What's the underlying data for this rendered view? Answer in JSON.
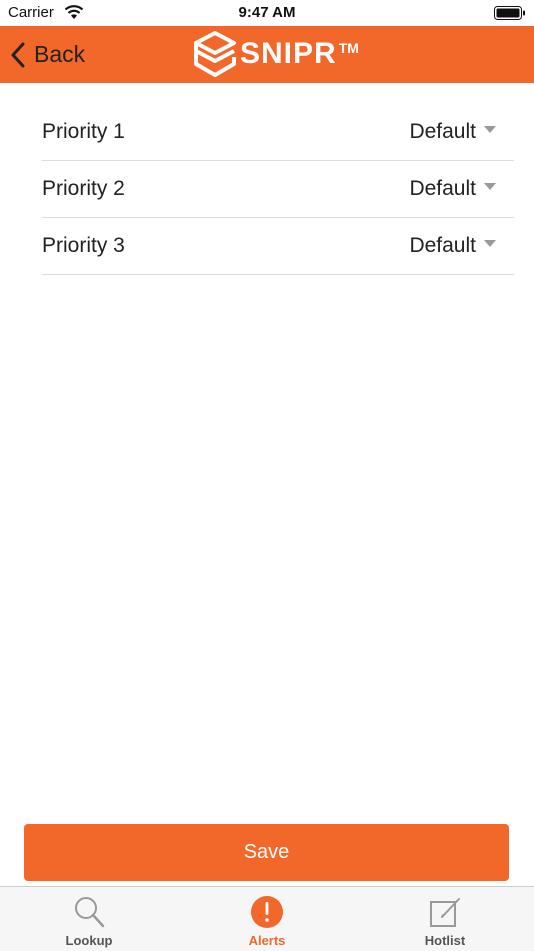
{
  "status_bar": {
    "carrier": "Carrier",
    "time": "9:47 AM"
  },
  "nav": {
    "back_label": "Back",
    "logo_text": "SNIPR",
    "logo_tm": "TM"
  },
  "priorities": [
    {
      "label": "Priority 1",
      "value": "Default"
    },
    {
      "label": "Priority 2",
      "value": "Default"
    },
    {
      "label": "Priority 3",
      "value": "Default"
    }
  ],
  "save_label": "Save",
  "tabs": [
    {
      "label": "Lookup",
      "icon": "magnifier-icon",
      "active": false
    },
    {
      "label": "Alerts",
      "icon": "alert-icon",
      "active": true
    },
    {
      "label": "Hotlist",
      "icon": "edit-icon",
      "active": false
    }
  ],
  "colors": {
    "accent": "#f2682a"
  }
}
